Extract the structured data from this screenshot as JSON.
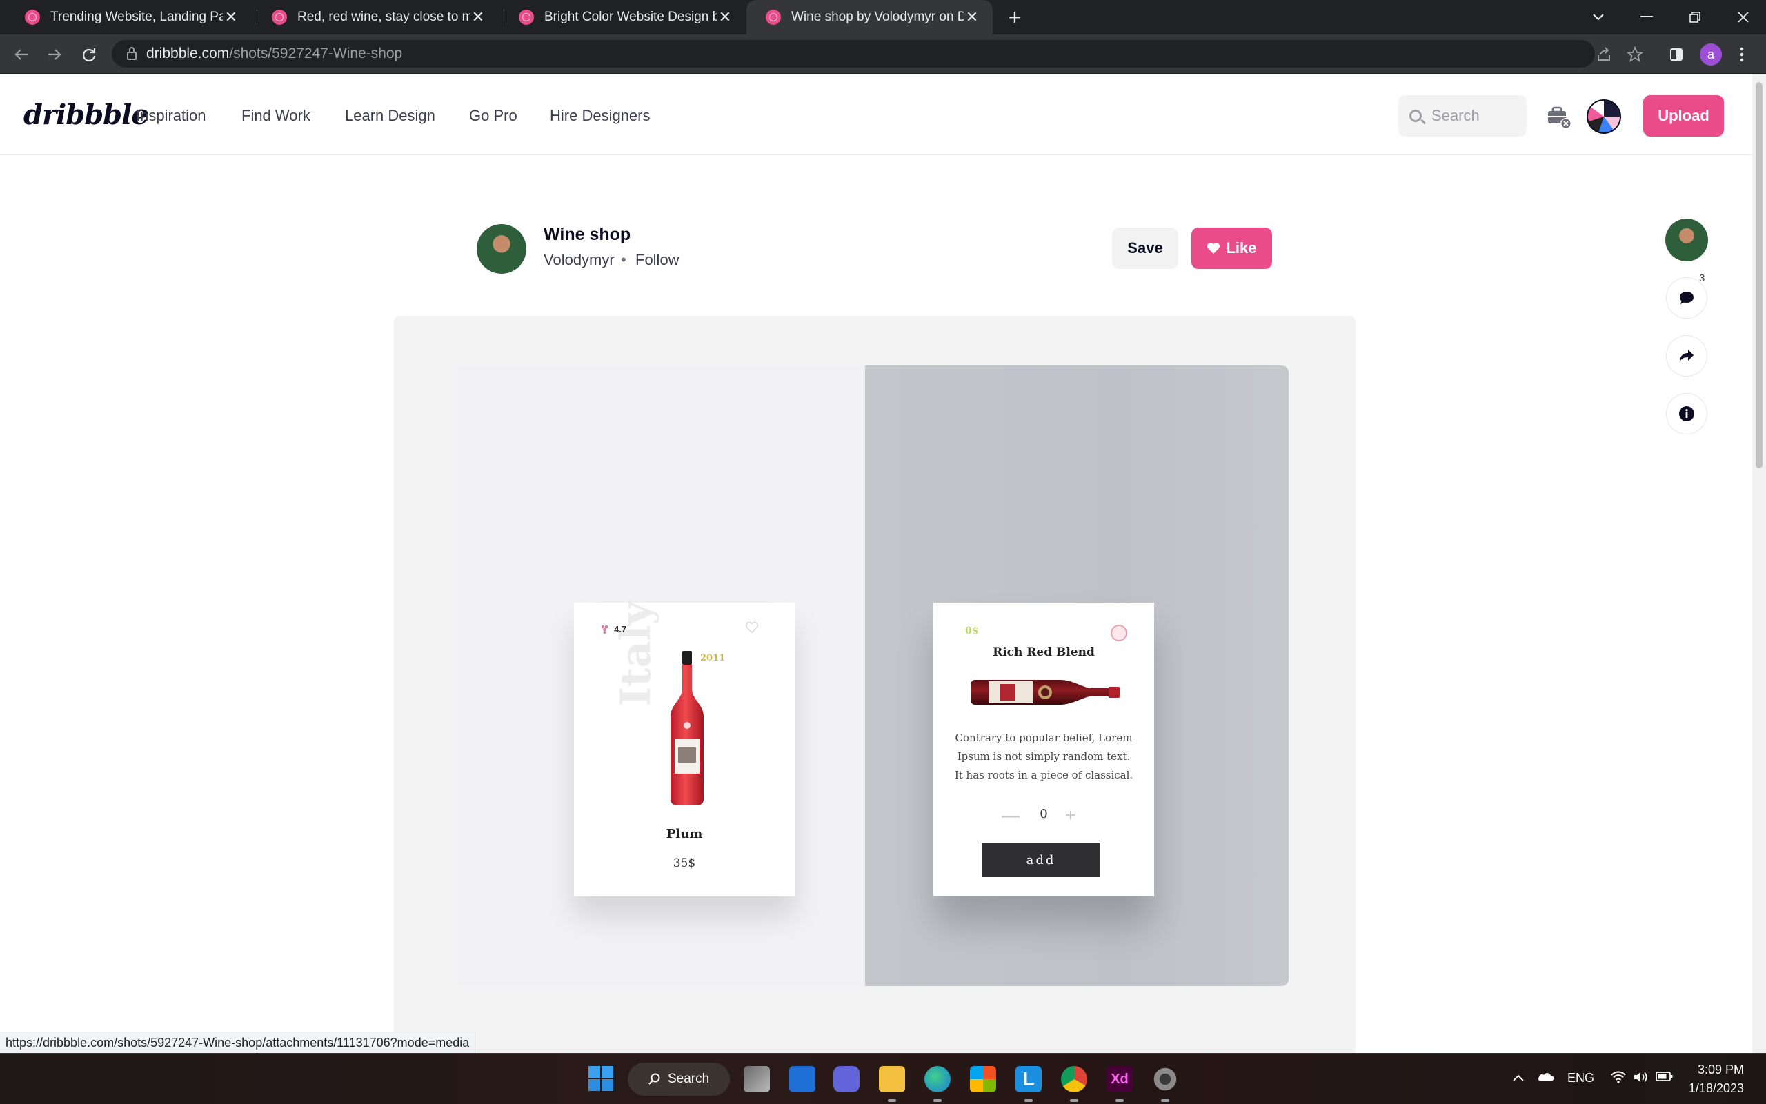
{
  "browser": {
    "tabs": [
      {
        "title": "Trending Website, Landing Page and"
      },
      {
        "title": "Red, red wine, stay close to me. by"
      },
      {
        "title": "Bright Color Website Design by L"
      },
      {
        "title": "Wine shop by Volodymyr on Dribbble"
      }
    ],
    "tab_close_glyph": "✕",
    "new_tab_glyph": "+",
    "url_host": "dribbble.com",
    "url_path": "/shots/5927247-Wine-shop",
    "profile_initial": "a"
  },
  "site": {
    "logo": "dribbble",
    "nav": [
      "Inspiration",
      "Find Work",
      "Learn Design",
      "Go Pro",
      "Hire Designers"
    ],
    "search_placeholder": "Search",
    "upload_label": "Upload"
  },
  "shot": {
    "title": "Wine shop",
    "author": "Volodymyr",
    "separator": "•",
    "follow_label": "Follow",
    "save_label": "Save",
    "like_label": "Like",
    "comment_count": "3"
  },
  "design": {
    "left_card": {
      "rating": "4.7",
      "year": "2011",
      "watermark": "Italy",
      "name": "Plum",
      "price": "35$"
    },
    "right_card": {
      "price": "0$",
      "name": "Rich Red Blend",
      "description": "Contrary to popular belief, Lorem Ipsum is not simply random text. It has roots in a piece of classical.",
      "quantity": "0",
      "minus": "—",
      "plus": "+",
      "add_label": "add"
    }
  },
  "status_bar_url": "https://dribbble.com/shots/5927247-Wine-shop/attachments/11131706?mode=media",
  "taskbar": {
    "search_label": "Search",
    "language": "ENG",
    "time": "3:09 PM",
    "date": "1/18/2023"
  },
  "colors": {
    "brand_pink": "#ea4c89",
    "chrome_dark": "#202124",
    "chrome_mid": "#35363a"
  }
}
